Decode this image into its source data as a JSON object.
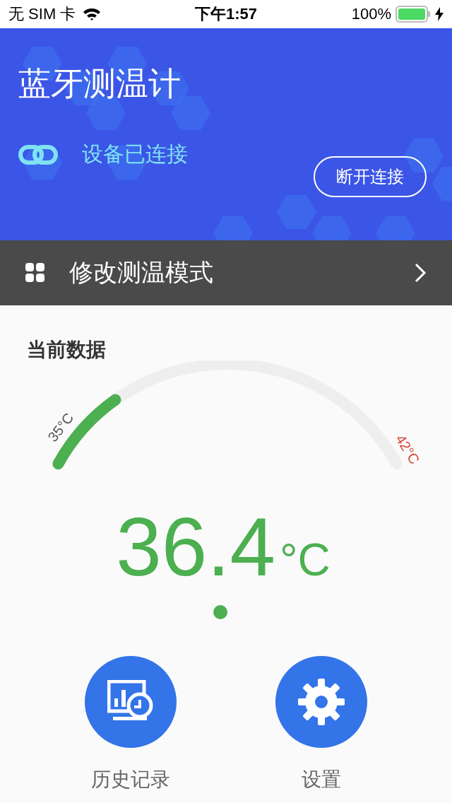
{
  "status_bar": {
    "carrier": "无 SIM 卡",
    "time": "下午1:57",
    "battery": "100%"
  },
  "header": {
    "title": "蓝牙测温计",
    "connection": "设备已连接",
    "connected": true,
    "button": "断开连接"
  },
  "mode_row": {
    "label": "修改测温模式"
  },
  "current": {
    "title": "当前数据",
    "gauge": {
      "min_label": "35°C",
      "max_label": "42°C"
    },
    "value": "36.4",
    "unit": "°C"
  },
  "actions": [
    {
      "kind": "history",
      "label": "历史记录"
    },
    {
      "kind": "settings",
      "label": "设置"
    }
  ]
}
